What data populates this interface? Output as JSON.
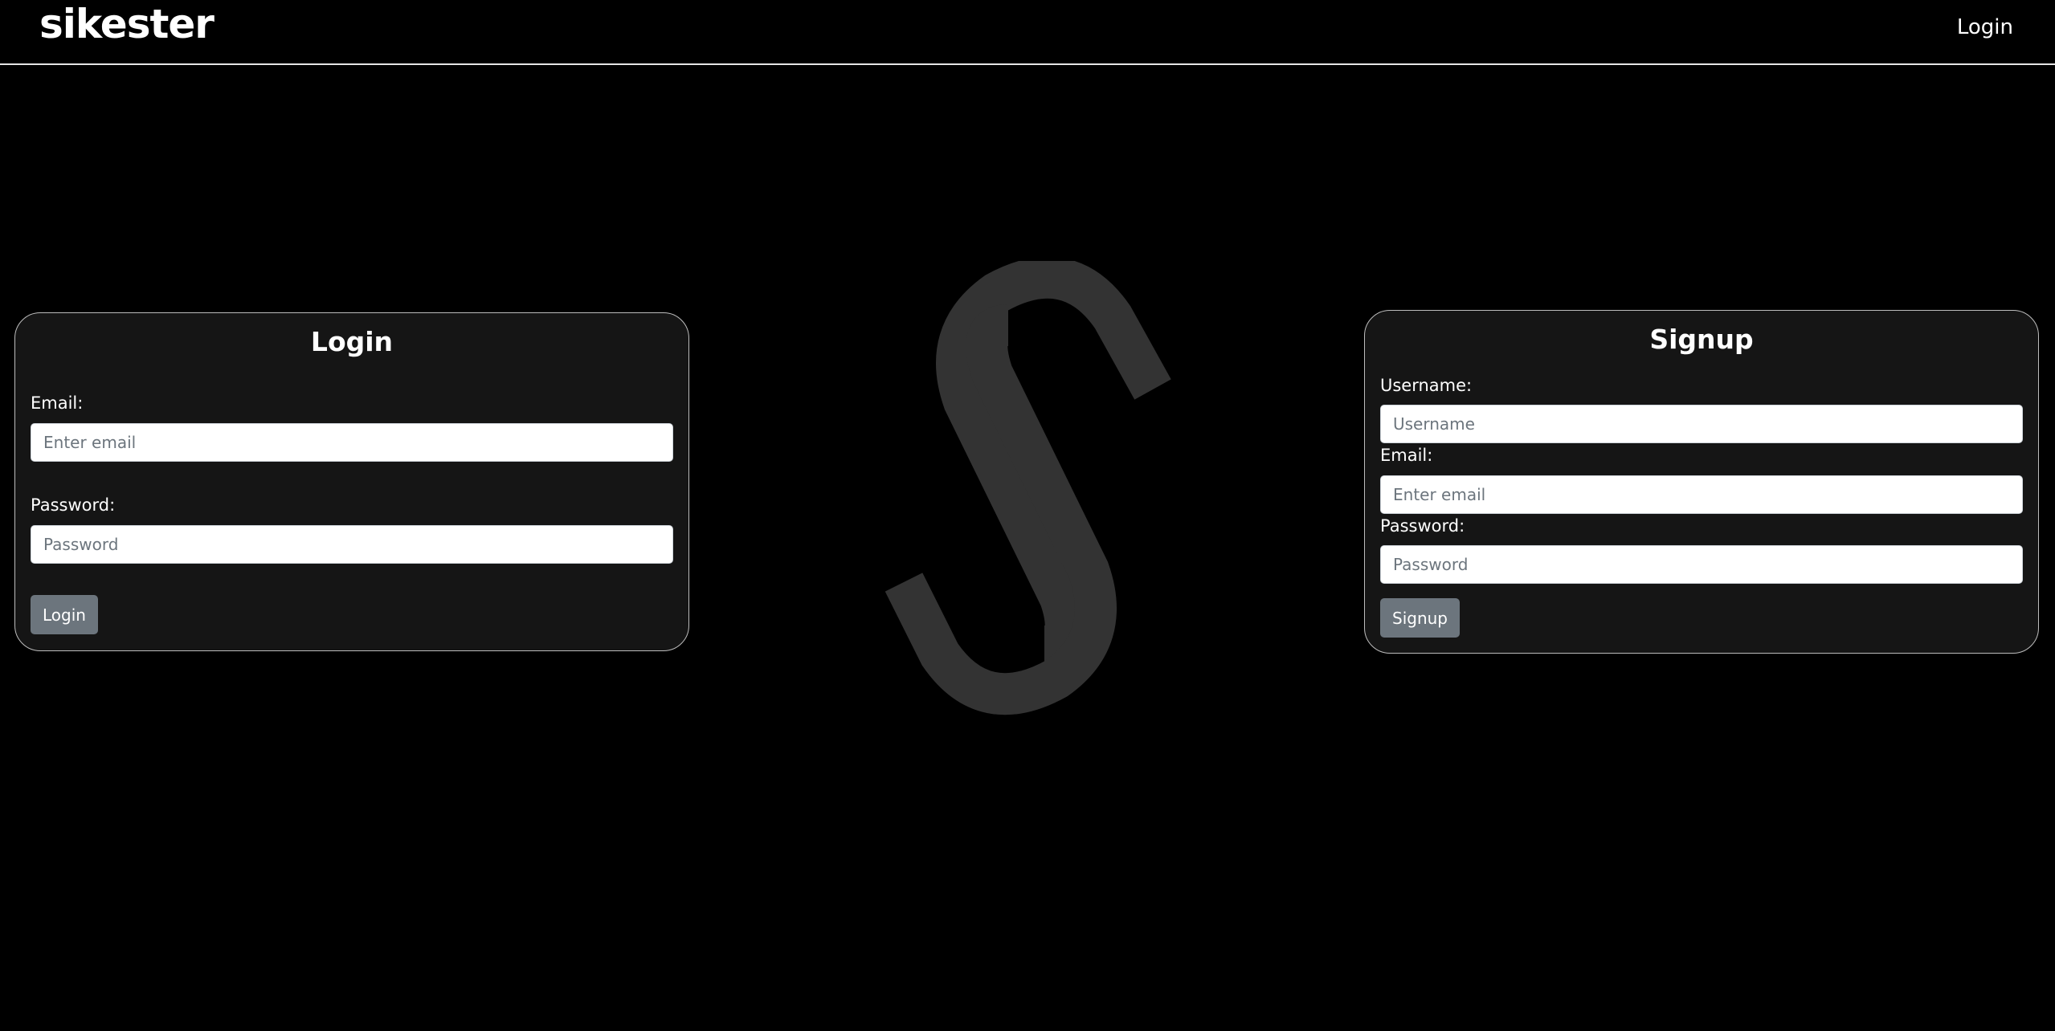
{
  "navbar": {
    "brand": "sikester",
    "login_link": "Login"
  },
  "login_card": {
    "title": "Login",
    "email_label": "Email:",
    "email_placeholder": "Enter email",
    "password_label": "Password:",
    "password_placeholder": "Password",
    "submit_label": "Login"
  },
  "signup_card": {
    "title": "Signup",
    "username_label": "Username:",
    "username_placeholder": "Username",
    "email_label": "Email:",
    "email_placeholder": "Enter email",
    "password_label": "Password:",
    "password_placeholder": "Password",
    "submit_label": "Signup"
  },
  "logo": {
    "icon": "sikester-s-logo",
    "color": "#333333"
  },
  "colors": {
    "background": "#000000",
    "card_background": "#151515",
    "button": "#6c757d"
  }
}
